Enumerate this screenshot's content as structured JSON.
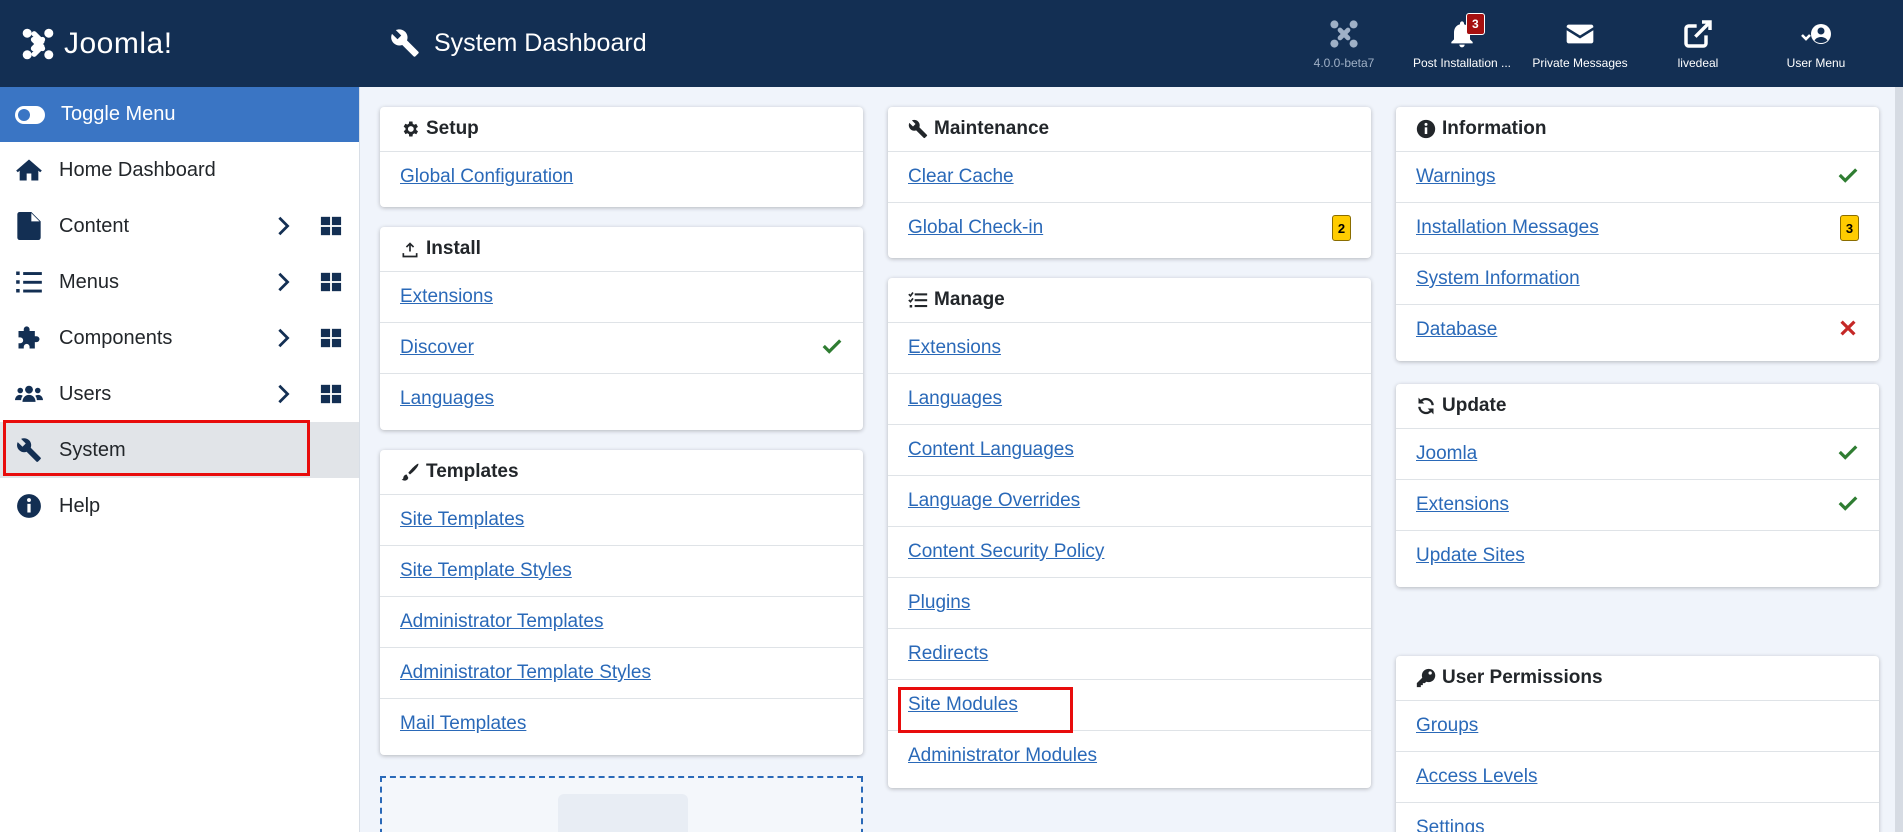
{
  "header": {
    "logo_text": "Joomla!",
    "page_title": "System Dashboard",
    "items": [
      {
        "label": "4.0.0-beta7",
        "icon": "joomla-icon"
      },
      {
        "label": "Post Installation ...",
        "icon": "bell-icon",
        "badge": "3"
      },
      {
        "label": "Private Messages",
        "icon": "envelope-icon"
      },
      {
        "label": "livedeal",
        "icon": "external-link-icon"
      },
      {
        "label": "User Menu",
        "icon": "user-circle-icon"
      }
    ]
  },
  "sidebar": {
    "toggle_label": "Toggle Menu",
    "items": [
      {
        "label": "Home Dashboard",
        "icon": "home-icon"
      },
      {
        "label": "Content",
        "icon": "file-icon"
      },
      {
        "label": "Menus",
        "icon": "list-icon"
      },
      {
        "label": "Components",
        "icon": "puzzle-icon"
      },
      {
        "label": "Users",
        "icon": "users-icon"
      },
      {
        "label": "System",
        "icon": "wrench-icon"
      },
      {
        "label": "Help",
        "icon": "info-icon"
      }
    ]
  },
  "cards": {
    "setup": {
      "title": "Setup",
      "links": [
        "Global Configuration"
      ]
    },
    "install": {
      "title": "Install",
      "links": [
        "Extensions",
        "Discover",
        "Languages"
      ]
    },
    "templates": {
      "title": "Templates",
      "links": [
        "Site Templates",
        "Site Template Styles",
        "Administrator Templates",
        "Administrator Template Styles",
        "Mail Templates"
      ]
    },
    "maintenance": {
      "title": "Maintenance",
      "links": [
        "Clear Cache",
        "Global Check-in"
      ],
      "checkin_badge": "2"
    },
    "manage": {
      "title": "Manage",
      "links": [
        "Extensions",
        "Languages",
        "Content Languages",
        "Language Overrides",
        "Content Security Policy",
        "Plugins",
        "Redirects",
        "Site Modules",
        "Administrator Modules"
      ]
    },
    "information": {
      "title": "Information",
      "links": [
        "Warnings",
        "Installation Messages",
        "System Information",
        "Database"
      ],
      "install_badge": "3"
    },
    "update": {
      "title": "Update",
      "links": [
        "Joomla",
        "Extensions",
        "Update Sites"
      ]
    },
    "permissions": {
      "title": "User Permissions",
      "links": [
        "Groups",
        "Access Levels",
        "Settings"
      ]
    }
  },
  "colors": {
    "header": "#132f53",
    "link": "#2a69b8",
    "accent": "#3a75c4",
    "success": "#2f7d32",
    "danger": "#c52827",
    "badge": "#ffcc00"
  }
}
